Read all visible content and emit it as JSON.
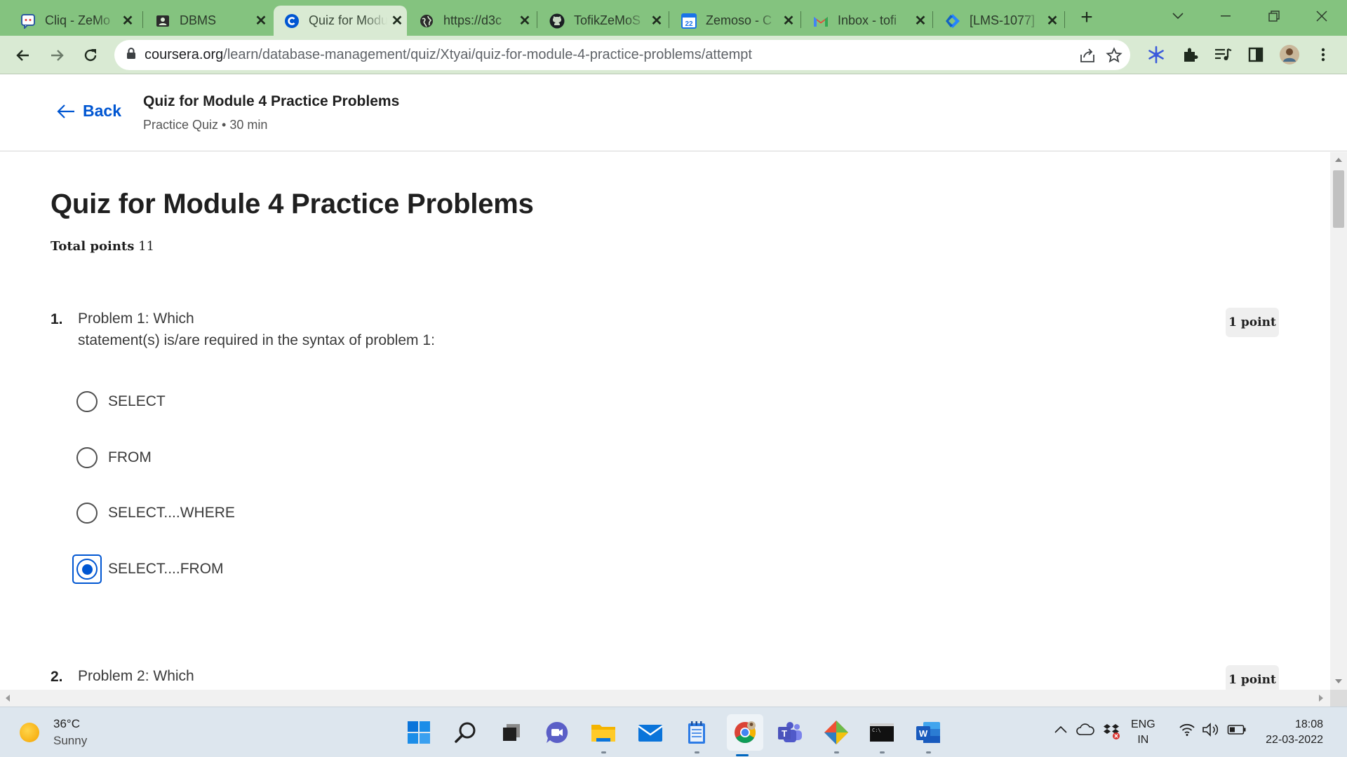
{
  "browser": {
    "tabs": [
      {
        "label": "Cliq - ZeMo",
        "icon": "cliq-icon",
        "active": false
      },
      {
        "label": "DBMS",
        "icon": "contact-card-icon",
        "active": false
      },
      {
        "label": "Quiz for Module",
        "icon": "coursera-icon",
        "active": true
      },
      {
        "label": "https://d3c",
        "icon": "globe-icon",
        "active": false
      },
      {
        "label": "TofikZeMoS",
        "icon": "github-icon",
        "active": false
      },
      {
        "label": "Zemoso - C",
        "icon": "calendar-icon",
        "active": false
      },
      {
        "label": "Inbox - tofi",
        "icon": "gmail-icon",
        "active": false
      },
      {
        "label": "[LMS-1077]",
        "icon": "jira-icon",
        "active": false
      }
    ],
    "calendar_day": "22",
    "url_domain": "coursera.org",
    "url_path": "/learn/database-management/quiz/Xtyai/quiz-for-module-4-practice-problems/attempt"
  },
  "header": {
    "back_label": "Back",
    "title": "Quiz for Module 4 Practice Problems",
    "subtitle": "Practice Quiz • 30 min"
  },
  "quiz": {
    "title": "Quiz for Module 4 Practice Problems",
    "total_points_label": "Total points",
    "total_points_value": "11",
    "questions": [
      {
        "number": "1.",
        "text_line1": "Problem 1: Which",
        "text_line2": "statement(s) is/are required in the syntax of problem 1:",
        "points": "1 point",
        "options": [
          "SELECT",
          "FROM",
          "SELECT....WHERE",
          "SELECT....FROM"
        ],
        "selected_index": 3
      },
      {
        "number": "2.",
        "text_line1": "Problem 2: Which",
        "points": "1 point"
      }
    ]
  },
  "taskbar": {
    "weather_temp": "36°C",
    "weather_desc": "Sunny",
    "lang_line1": "ENG",
    "lang_line2": "IN",
    "time": "18:08",
    "date": "22-03-2022"
  },
  "colors": {
    "tab_strip": "#84c37f",
    "toolbar": "#d9ead3",
    "accent_blue": "#0056d2"
  }
}
